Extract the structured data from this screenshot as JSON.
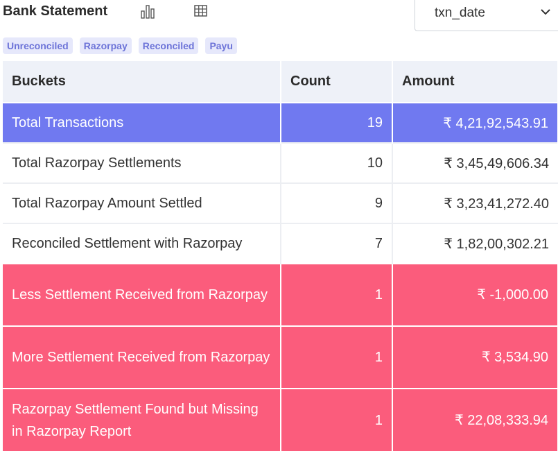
{
  "header": {
    "title": "Bank Statement",
    "chart_icon": "bar-chart-icon",
    "table_icon": "table-grid-icon",
    "date_select": {
      "value": "txn_date",
      "icon": "chevron-down-icon"
    }
  },
  "filters": [
    {
      "label": "Unreconciled"
    },
    {
      "label": "Razorpay"
    },
    {
      "label": "Reconciled"
    },
    {
      "label": "Payu"
    }
  ],
  "table": {
    "headers": [
      "Buckets",
      "Count",
      "Amount"
    ],
    "rows": [
      {
        "bucket": "Total Transactions",
        "count": "19",
        "amount": "₹ 4,21,92,543.91",
        "style": "total"
      },
      {
        "bucket": "Total Razorpay Settlements",
        "count": "10",
        "amount": "₹ 3,45,49,606.34",
        "style": "plain"
      },
      {
        "bucket": "Total Razorpay Amount Settled",
        "count": "9",
        "amount": "₹ 3,23,41,272.40",
        "style": "plain"
      },
      {
        "bucket": "Reconciled Settlement with Razorpay",
        "count": "7",
        "amount": "₹ 1,82,00,302.21",
        "style": "plain"
      },
      {
        "bucket": "Less Settlement Received from Razorpay",
        "count": "1",
        "amount": "₹ -1,000.00",
        "style": "red"
      },
      {
        "bucket": "More Settlement Received from Razorpay",
        "count": "1",
        "amount": "₹ 3,534.90",
        "style": "red"
      },
      {
        "bucket": "Razorpay Settlement Found but Missing in Razorpay Report",
        "count": "1",
        "amount": "₹ 22,08,333.94",
        "style": "red"
      }
    ]
  },
  "colors": {
    "accent": "#7079f0",
    "alert": "#fb5c7c",
    "chip_bg": "#e6e8fb",
    "chip_text": "#6d74d8",
    "header_bg": "#eef1f8"
  }
}
